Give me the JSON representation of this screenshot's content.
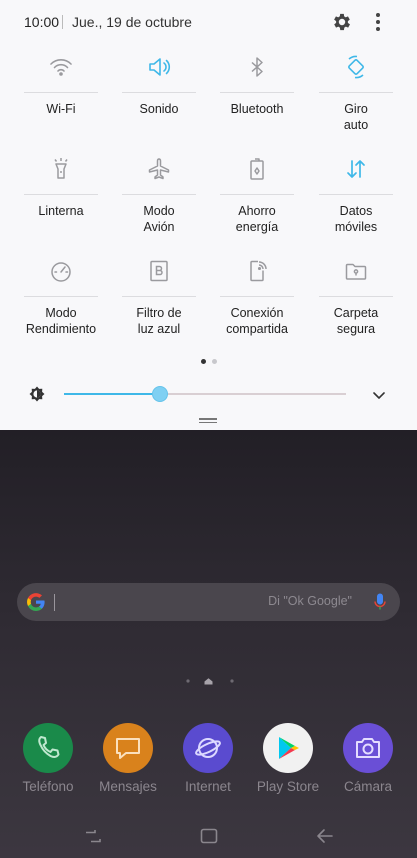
{
  "status_bar": {
    "time": "10:00",
    "date": "Jue., 19 de octubre",
    "icons": [
      "gear-icon",
      "more-vert-icon"
    ]
  },
  "quick_tiles": [
    {
      "label": "Wi-Fi",
      "icon": "wifi-icon",
      "active": false
    },
    {
      "label": "Sonido",
      "icon": "volume-icon",
      "active": true
    },
    {
      "label": "Bluetooth",
      "icon": "bluetooth-icon",
      "active": false
    },
    {
      "label": "Giro\nauto",
      "icon": "auto-rotate-icon",
      "active": true
    },
    {
      "label": "Linterna",
      "icon": "flashlight-icon",
      "active": false
    },
    {
      "label": "Modo\nAvión",
      "icon": "airplane-icon",
      "active": false
    },
    {
      "label": "Ahorro\nenergía",
      "icon": "battery-saver-icon",
      "active": false
    },
    {
      "label": "Datos\nmóviles",
      "icon": "mobile-data-icon",
      "active": true
    },
    {
      "label": "Modo\nRendimiento",
      "icon": "performance-icon",
      "active": false
    },
    {
      "label": "Filtro de\nluz azul",
      "icon": "blue-light-icon",
      "active": false
    },
    {
      "label": "Conexión\ncompartida",
      "icon": "hotspot-icon",
      "active": false
    },
    {
      "label": "Carpeta\nsegura",
      "icon": "secure-folder-icon",
      "active": false
    }
  ],
  "pagination": {
    "current": 1,
    "total": 2
  },
  "brightness": {
    "level": 0.34,
    "icon": "brightness-icon"
  },
  "search_bar": {
    "placeholder": "Di \"Ok Google\"",
    "icons": [
      "google-icon",
      "mic-icon"
    ]
  },
  "dock": [
    {
      "label": "Teléfono",
      "icon": "phone-icon",
      "color": "#1a8a4a"
    },
    {
      "label": "Mensajes",
      "icon": "message-icon",
      "color": "#d9821c"
    },
    {
      "label": "Internet",
      "icon": "internet-icon",
      "color": "#5a4bcf"
    },
    {
      "label": "Play Store",
      "icon": "play-store-icon",
      "color": "#f1f1f1"
    },
    {
      "label": "Cámara",
      "icon": "camera-icon",
      "color": "#6a4fd6"
    }
  ],
  "colors": {
    "accent": "#3fb8e8",
    "inactive_icon": "#8a8a8e",
    "panel_bg": "#f8f8fa"
  }
}
